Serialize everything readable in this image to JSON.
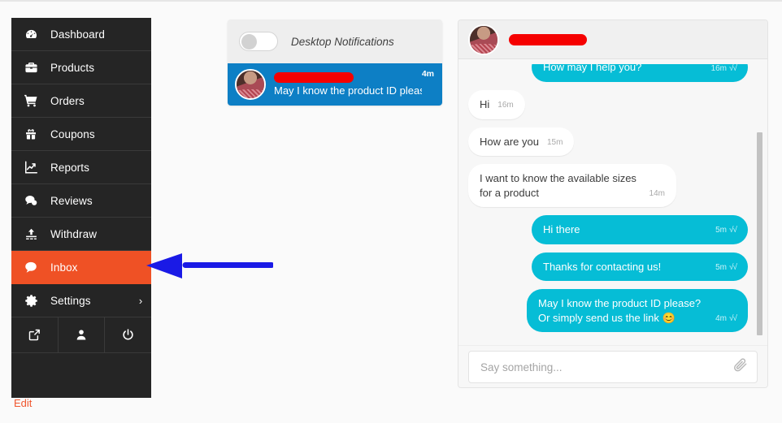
{
  "sidebar": {
    "items": [
      {
        "label": "Dashboard",
        "icon": "dashboard-icon",
        "active": false
      },
      {
        "label": "Products",
        "icon": "briefcase-icon",
        "active": false
      },
      {
        "label": "Orders",
        "icon": "cart-icon",
        "active": false
      },
      {
        "label": "Coupons",
        "icon": "gift-icon",
        "active": false
      },
      {
        "label": "Reports",
        "icon": "chart-line-icon",
        "active": false
      },
      {
        "label": "Reviews",
        "icon": "comments-icon",
        "active": false
      },
      {
        "label": "Withdraw",
        "icon": "upload-icon",
        "active": false
      },
      {
        "label": "Inbox",
        "icon": "chat-bubble-icon",
        "active": true
      },
      {
        "label": "Settings",
        "icon": "gear-icon",
        "active": false,
        "caret": "›"
      }
    ],
    "icon_row": [
      {
        "name": "external-link-icon"
      },
      {
        "name": "user-icon"
      },
      {
        "name": "power-icon"
      }
    ],
    "edit_label": "Edit",
    "active_color": "#ef5125",
    "background_color": "#252525",
    "edit_color": "#f0562e"
  },
  "annotation": {
    "arrow_color": "#1a1ae6",
    "arrow_direction": "left",
    "points_to": "Inbox"
  },
  "notifications": {
    "toggle_label": "Desktop Notifications",
    "toggle_on": false,
    "item": {
      "sender_redacted": true,
      "message": "May I know the product ID pleas...",
      "time": "4m",
      "selected": true,
      "selected_color": "#0d7fc5"
    }
  },
  "chat": {
    "header": {
      "name_redacted": true,
      "avatar": "user-avatar"
    },
    "messages": [
      {
        "direction": "out",
        "text": "How may I help you?",
        "time": "16m",
        "ticks": "√√",
        "clipped": true
      },
      {
        "direction": "in",
        "text": "Hi",
        "time": "16m"
      },
      {
        "direction": "in",
        "text": "How are you",
        "time": "15m"
      },
      {
        "direction": "in",
        "text": "I want to know the available sizes for a product",
        "time": "14m"
      },
      {
        "direction": "out",
        "text": "Hi there",
        "time": "5m",
        "ticks": "√√"
      },
      {
        "direction": "out",
        "text": "Thanks for contacting us!",
        "time": "5m",
        "ticks": "√√"
      },
      {
        "direction": "out",
        "text": "May I know the product ID please? Or simply send us the link 😊",
        "time": "4m",
        "ticks": "√√"
      }
    ],
    "bubble_out_color": "#06bdd6",
    "bubble_in_color": "#ffffff",
    "input_placeholder": "Say something...",
    "input_value": "",
    "attach_icon": "paperclip-icon"
  }
}
